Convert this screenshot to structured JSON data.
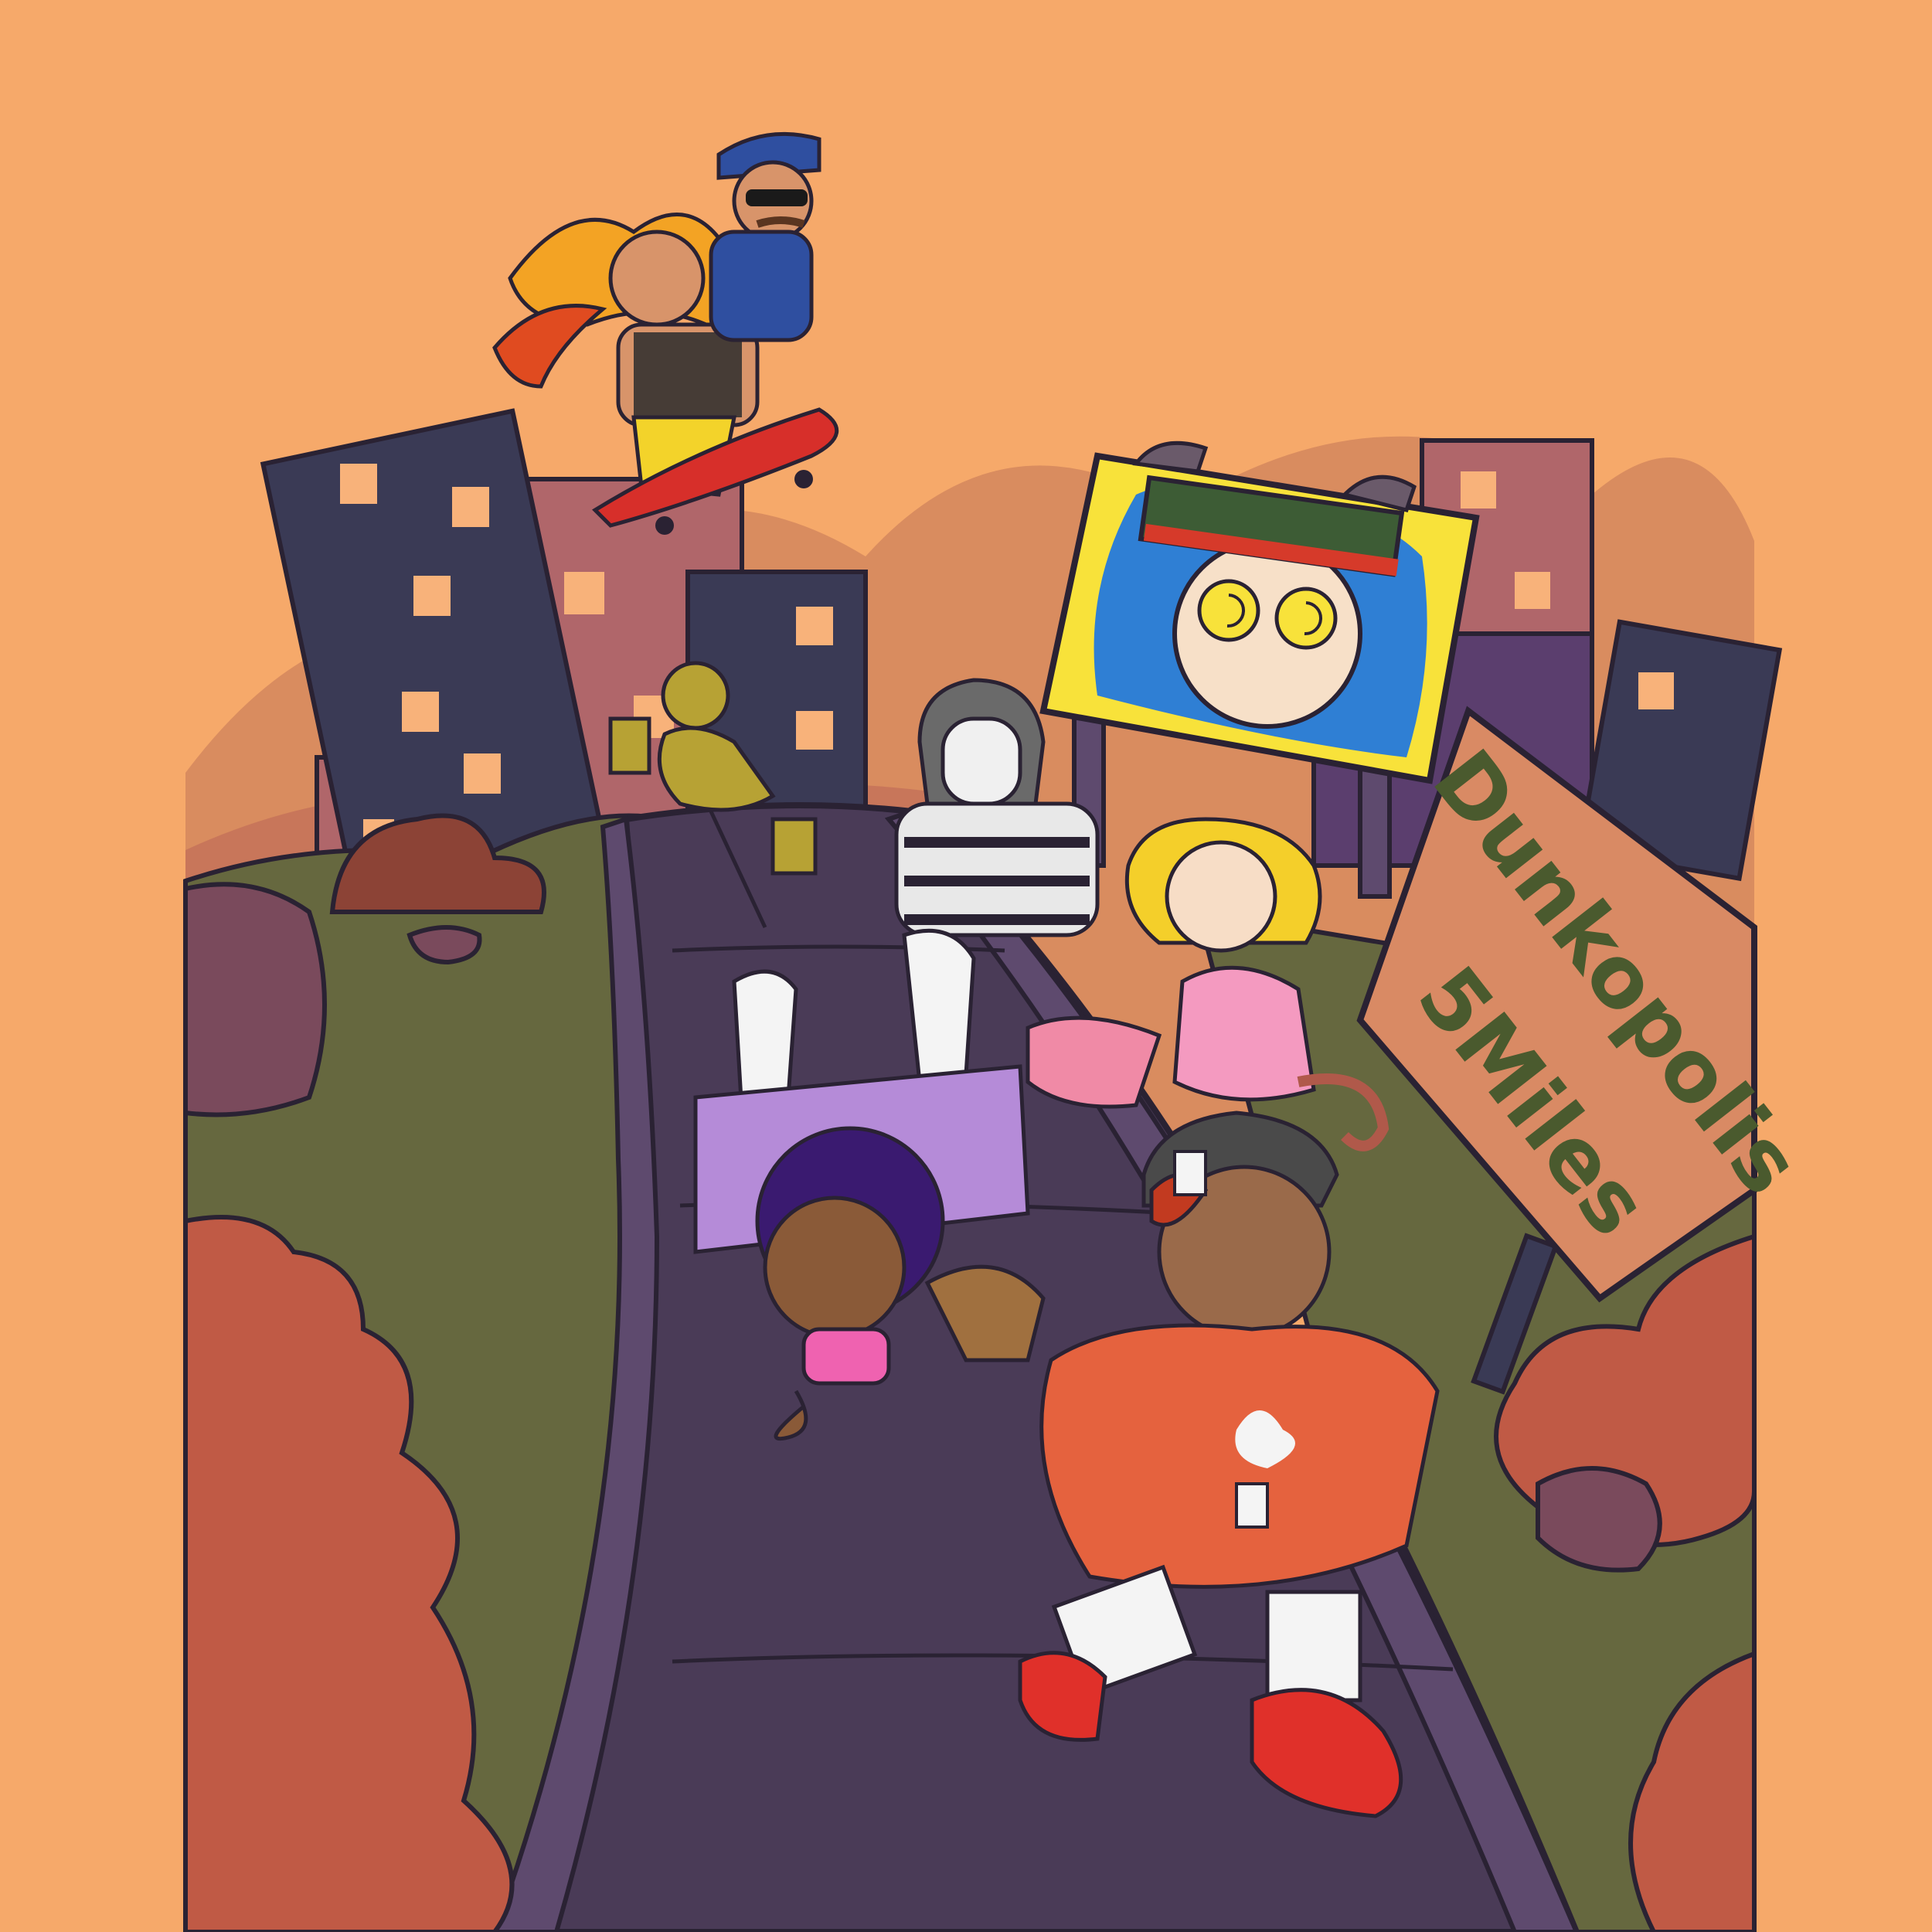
{
  "sign": {
    "line1": "Dunkopolis",
    "line2": "5Miles"
  },
  "colors": {
    "sky": "#f6a96a",
    "hills_far": "#d98c5f",
    "hills_mid": "#c8765a",
    "building_dark": "#3a3a55",
    "building_mauve": "#b0666a",
    "window": "#f8b27a",
    "grass": "#66683f",
    "road": "#4a3b57",
    "road_edge": "#5e4a6e",
    "bush": "#c05a45",
    "sign_board": "#d98a64",
    "sign_text": "#4a5a2e",
    "billboard_yellow": "#f8e23a",
    "billboard_blue": "#2f7fd4"
  },
  "characters": [
    "flaming-skater-character",
    "police-officer-character",
    "golden-statue-character",
    "masked-hoodie-character",
    "monkey-girl-character",
    "breakdancer-character",
    "card-thrower-character"
  ]
}
